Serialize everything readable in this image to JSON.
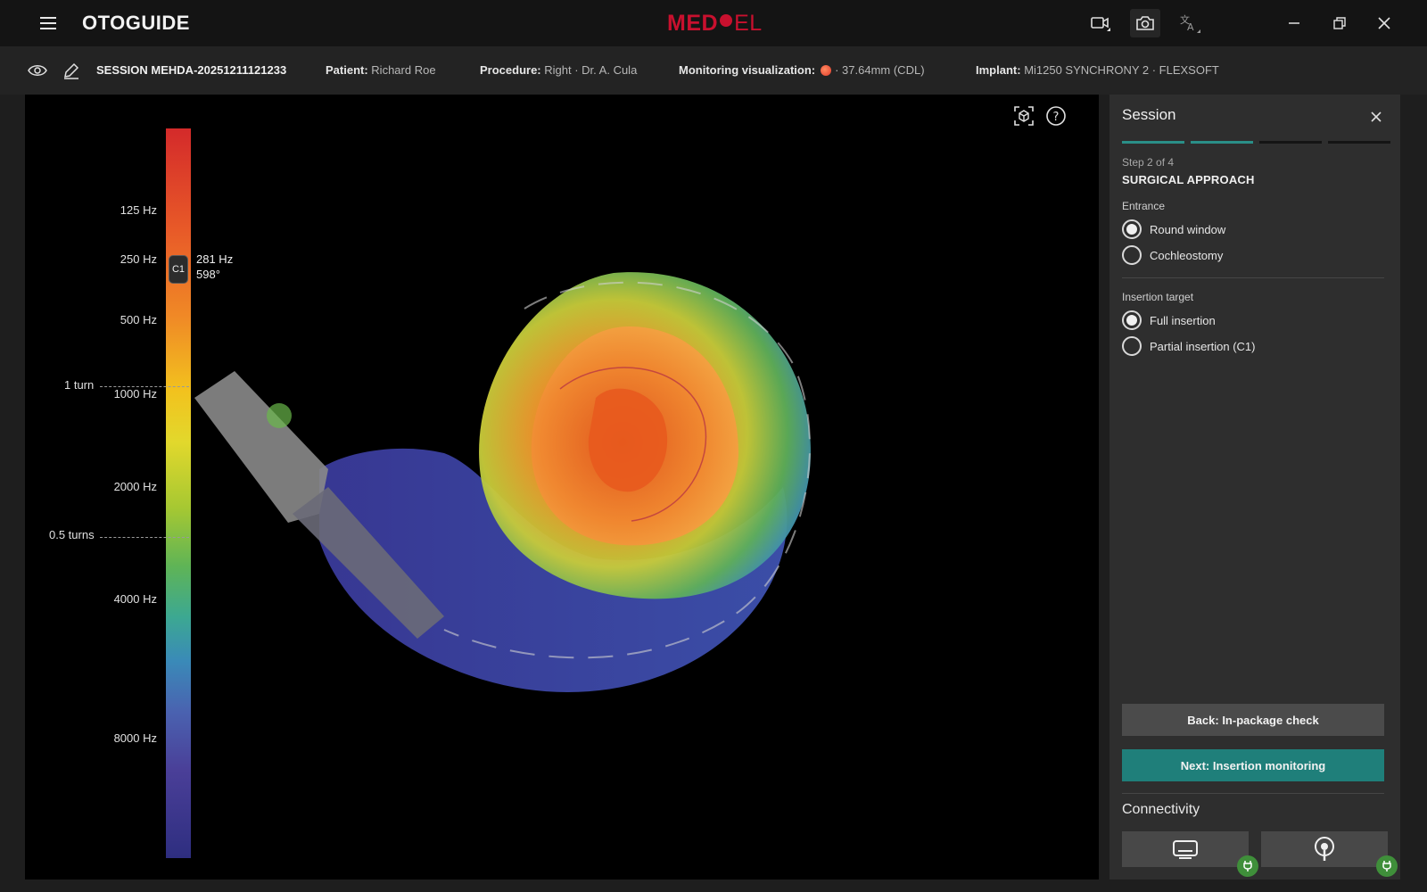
{
  "app": {
    "title": "OTOGUIDE",
    "brand_left": "MED",
    "brand_right": "EL",
    "brand_color": "#c8102e"
  },
  "titlebar": {
    "icons": [
      "video-camera-icon",
      "camera-icon",
      "translate-icon"
    ],
    "window_controls": [
      "minimize-icon",
      "restore-icon",
      "close-icon"
    ]
  },
  "session": {
    "id": "SESSION MEHDA-20251211121233",
    "patient_label": "Patient:",
    "patient_value": "Richard Roe",
    "procedure_label": "Procedure:",
    "procedure_value": "Right · Dr. A. Cula",
    "monitoring_label": "Monitoring visualization:",
    "monitoring_value": "· 37.64mm (CDL)",
    "implant_label": "Implant:",
    "implant_value": "Mi1250 SYNCHRONY 2 · FLEXSOFT"
  },
  "viewer": {
    "frequency_labels": [
      "125 Hz",
      "250 Hz",
      "500 Hz",
      "1000 Hz",
      "2000 Hz",
      "4000 Hz",
      "8000 Hz"
    ],
    "turn_labels": [
      "1 turn",
      "0.5 turns"
    ],
    "marker": {
      "badge": "C1",
      "frequency": "281 Hz",
      "angle": "598°"
    }
  },
  "panel": {
    "title": "Session",
    "step": "Step 2 of 4",
    "step_name": "SURGICAL APPROACH",
    "progress": {
      "completed_steps": 2,
      "total_steps": 4,
      "active_color": "#2a8f88",
      "inactive_color": "#141414"
    },
    "entrance": {
      "label": "Entrance",
      "options": [
        "Round window",
        "Cochleostomy"
      ],
      "selected": "Round window"
    },
    "insertion_target": {
      "label": "Insertion target",
      "options": [
        "Full insertion",
        "Partial insertion (C1)"
      ],
      "selected": "Full insertion"
    },
    "back_button": "Back: In-package check",
    "next_button": "Next: Insertion monitoring",
    "connectivity_title": "Connectivity",
    "connectivity_devices": [
      "monitor-device-icon",
      "probe-device-icon"
    ],
    "connection_status_color": "#3f8f3a"
  }
}
